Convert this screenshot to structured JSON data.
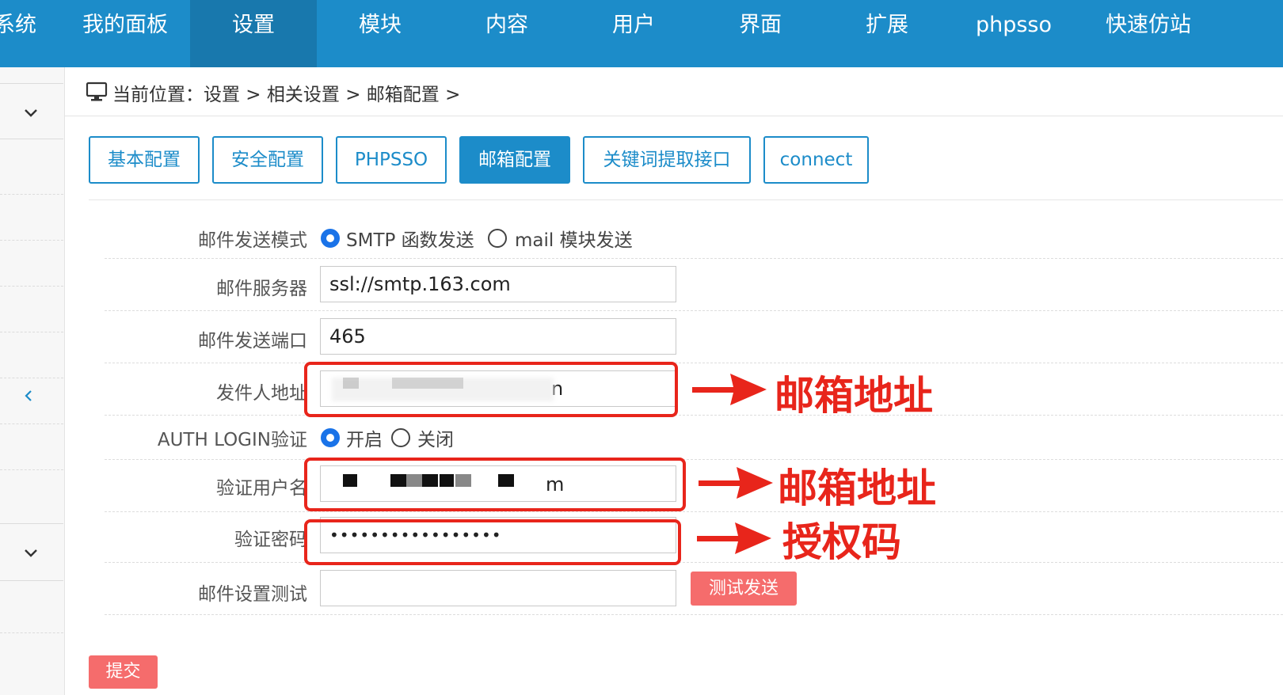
{
  "nav": {
    "items": [
      {
        "label": "系统"
      },
      {
        "label": "我的面板"
      },
      {
        "label": "设置",
        "active": true
      },
      {
        "label": "模块"
      },
      {
        "label": "内容"
      },
      {
        "label": "用户"
      },
      {
        "label": "界面"
      },
      {
        "label": "扩展"
      },
      {
        "label": "phpsso"
      },
      {
        "label": "快速仿站"
      }
    ]
  },
  "breadcrumb": {
    "prefix": "当前位置：",
    "path": "设置 > 相关设置 > 邮箱配置 >"
  },
  "tabs": [
    {
      "label": "基本配置"
    },
    {
      "label": "安全配置"
    },
    {
      "label": "PHPSSO"
    },
    {
      "label": "邮箱配置",
      "active": true
    },
    {
      "label": "关键词提取接口"
    },
    {
      "label": "connect"
    }
  ],
  "form": {
    "mode": {
      "label": "邮件发送模式",
      "option_smtp": "SMTP 函数发送",
      "option_mail": "mail 模块发送",
      "selected": "smtp"
    },
    "server": {
      "label": "邮件服务器",
      "value": "ssl://smtp.163.com"
    },
    "port": {
      "label": "邮件发送端口",
      "value": "465"
    },
    "sender": {
      "label": "发件人地址",
      "value_visible": "n"
    },
    "auth": {
      "label": "AUTH LOGIN验证",
      "option_on": "开启",
      "option_off": "关闭",
      "selected": "on"
    },
    "username": {
      "label": "验证用户名",
      "value_visible": "m"
    },
    "password": {
      "label": "验证密码",
      "value": "•••••••••••••••••"
    },
    "test": {
      "label": "邮件设置测试",
      "value": "",
      "button": "测试发送"
    },
    "submit": "提交"
  },
  "annotations": {
    "sender_note": "邮箱地址",
    "username_note": "邮箱地址",
    "password_note": "授权码",
    "color": "#e8251b"
  },
  "colors": {
    "brand": "#1c8cc9",
    "nav_active": "#1878ad",
    "danger_button": "#f56c6c",
    "radio_checked": "#1a73e8"
  }
}
